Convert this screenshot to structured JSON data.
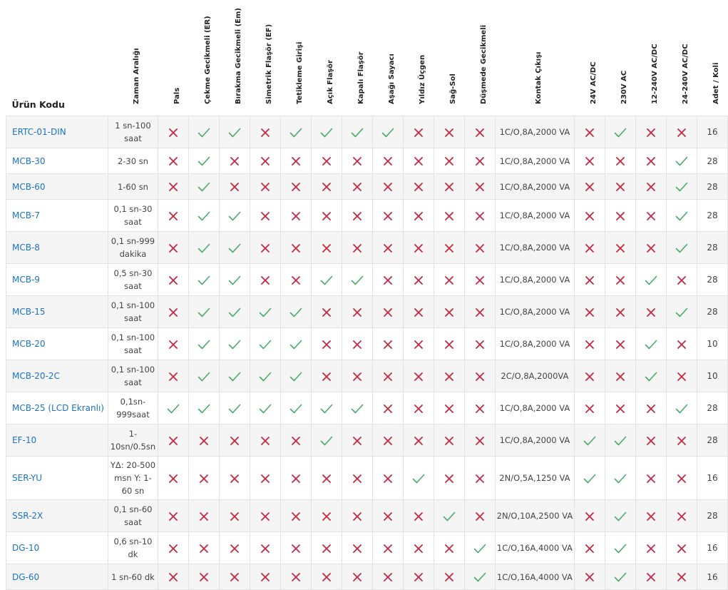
{
  "colors": {
    "check": "#4aab6a",
    "cross": "#c6293f",
    "link": "#1a73c8"
  },
  "headers": {
    "code": "Ürün Kodu",
    "range": "Zaman Aralığı",
    "f1": "Pals",
    "f2": "Çekme Gecikmeli (ER)",
    "f3": "Bırakma Gecikmeli (Em)",
    "f4": "Simetrik Flaşör (EF)",
    "f5": "Tetikleme Girişi",
    "f6": "Açık Flaşör",
    "f7": "Kapalı Flaşör",
    "f8": "Aşağı Sayacı",
    "f9": "Yıldız Üçgen",
    "f10": "Sağ-Sol",
    "f11": "Düşmede Gecikmeli",
    "kontak": "Kontak Çıkışı",
    "v1": "24V AC/DC",
    "v2": "230V AC",
    "v3": "12-240V AC/DC",
    "v4": "24-240V AC/DC",
    "qty": "Adet / Koli"
  },
  "rows": [
    {
      "code": "ERTC-01-DIN",
      "range": "1 sn-100 saat",
      "f": [
        0,
        1,
        1,
        0,
        1,
        1,
        1,
        1,
        0,
        0,
        0
      ],
      "kontak": "1C/O,8A,2000 VA",
      "v": [
        0,
        1,
        0,
        0
      ],
      "qty": "16"
    },
    {
      "code": "MCB-30",
      "range": "2-30 sn",
      "f": [
        0,
        1,
        0,
        0,
        0,
        0,
        0,
        0,
        0,
        0,
        0
      ],
      "kontak": "1C/O,8A,2000 VA",
      "v": [
        0,
        0,
        0,
        1
      ],
      "qty": "28"
    },
    {
      "code": "MCB-60",
      "range": "1-60 sn",
      "f": [
        0,
        1,
        0,
        0,
        0,
        0,
        0,
        0,
        0,
        0,
        0
      ],
      "kontak": "1C/O,8A,2000 VA",
      "v": [
        0,
        0,
        0,
        1
      ],
      "qty": "28"
    },
    {
      "code": "MCB-7",
      "range": "0,1 sn-30 saat",
      "f": [
        0,
        1,
        1,
        0,
        0,
        0,
        0,
        0,
        0,
        0,
        0
      ],
      "kontak": "1C/O,8A,2000 VA",
      "v": [
        0,
        0,
        0,
        1
      ],
      "qty": "28"
    },
    {
      "code": "MCB-8",
      "range": "0,1 sn-999 dakika",
      "f": [
        0,
        1,
        1,
        0,
        0,
        0,
        0,
        0,
        0,
        0,
        0
      ],
      "kontak": "1C/O,8A,2000 VA",
      "v": [
        0,
        0,
        0,
        1
      ],
      "qty": "28"
    },
    {
      "code": "MCB-9",
      "range": "0,5 sn-30 saat",
      "f": [
        0,
        1,
        1,
        0,
        0,
        1,
        1,
        0,
        0,
        0,
        0
      ],
      "kontak": "1C/O,8A,2000 VA",
      "v": [
        0,
        0,
        1,
        0
      ],
      "qty": "28"
    },
    {
      "code": "MCB-15",
      "range": "0,1 sn-100 saat",
      "f": [
        0,
        1,
        1,
        1,
        1,
        0,
        0,
        0,
        0,
        0,
        0
      ],
      "kontak": "1C/O,8A,2000 VA",
      "v": [
        0,
        0,
        0,
        1
      ],
      "qty": "28"
    },
    {
      "code": "MCB-20",
      "range": "0,1 sn-100 saat",
      "f": [
        0,
        1,
        1,
        1,
        1,
        0,
        0,
        0,
        0,
        0,
        0
      ],
      "kontak": "1C/O,8A,2000 VA",
      "v": [
        0,
        0,
        1,
        0
      ],
      "qty": "10"
    },
    {
      "code": "MCB-20-2C",
      "range": "0,1 sn-100 saat",
      "f": [
        0,
        1,
        1,
        1,
        1,
        0,
        0,
        0,
        0,
        0,
        0
      ],
      "kontak": "2C/O,8A,2000VA",
      "v": [
        0,
        0,
        1,
        0
      ],
      "qty": "10"
    },
    {
      "code": "MCB-25 (LCD Ekranlı)",
      "range": "0,1sn-999saat",
      "f": [
        1,
        1,
        1,
        1,
        1,
        1,
        1,
        0,
        0,
        0,
        0
      ],
      "kontak": "1C/O,8A,2000 VA",
      "v": [
        0,
        0,
        0,
        1
      ],
      "qty": "28"
    },
    {
      "code": "EF-10",
      "range": "1-10sn/0.5sn",
      "f": [
        0,
        0,
        0,
        0,
        0,
        1,
        0,
        0,
        0,
        0,
        0
      ],
      "kontak": "1C/O,8A,2000 VA",
      "v": [
        1,
        1,
        0,
        0
      ],
      "qty": "28"
    },
    {
      "code": "SER-YU",
      "range": "YΔ: 20-500 msn Y: 1-60 sn",
      "f": [
        0,
        0,
        0,
        0,
        0,
        0,
        0,
        0,
        1,
        0,
        0
      ],
      "kontak": "2N/O,5A,1250 VA",
      "v": [
        1,
        1,
        0,
        0
      ],
      "qty": "16"
    },
    {
      "code": "SSR-2X",
      "range": "0,1 sn-60 saat",
      "f": [
        0,
        0,
        0,
        0,
        0,
        0,
        0,
        0,
        0,
        1,
        0
      ],
      "kontak": "2N/O,10A,2500 VA",
      "v": [
        0,
        1,
        0,
        0
      ],
      "qty": "28"
    },
    {
      "code": "DG-10",
      "range": "0,6 sn-10 dk",
      "f": [
        0,
        0,
        0,
        0,
        0,
        0,
        0,
        0,
        0,
        0,
        1
      ],
      "kontak": "1C/O,16A,4000 VA",
      "v": [
        0,
        1,
        0,
        0
      ],
      "qty": "16"
    },
    {
      "code": "DG-60",
      "range": "1 sn-60 dk",
      "f": [
        0,
        0,
        0,
        0,
        0,
        0,
        0,
        0,
        0,
        0,
        1
      ],
      "kontak": "1C/O,16A,4000 VA",
      "v": [
        0,
        1,
        0,
        0
      ],
      "qty": "16"
    }
  ]
}
